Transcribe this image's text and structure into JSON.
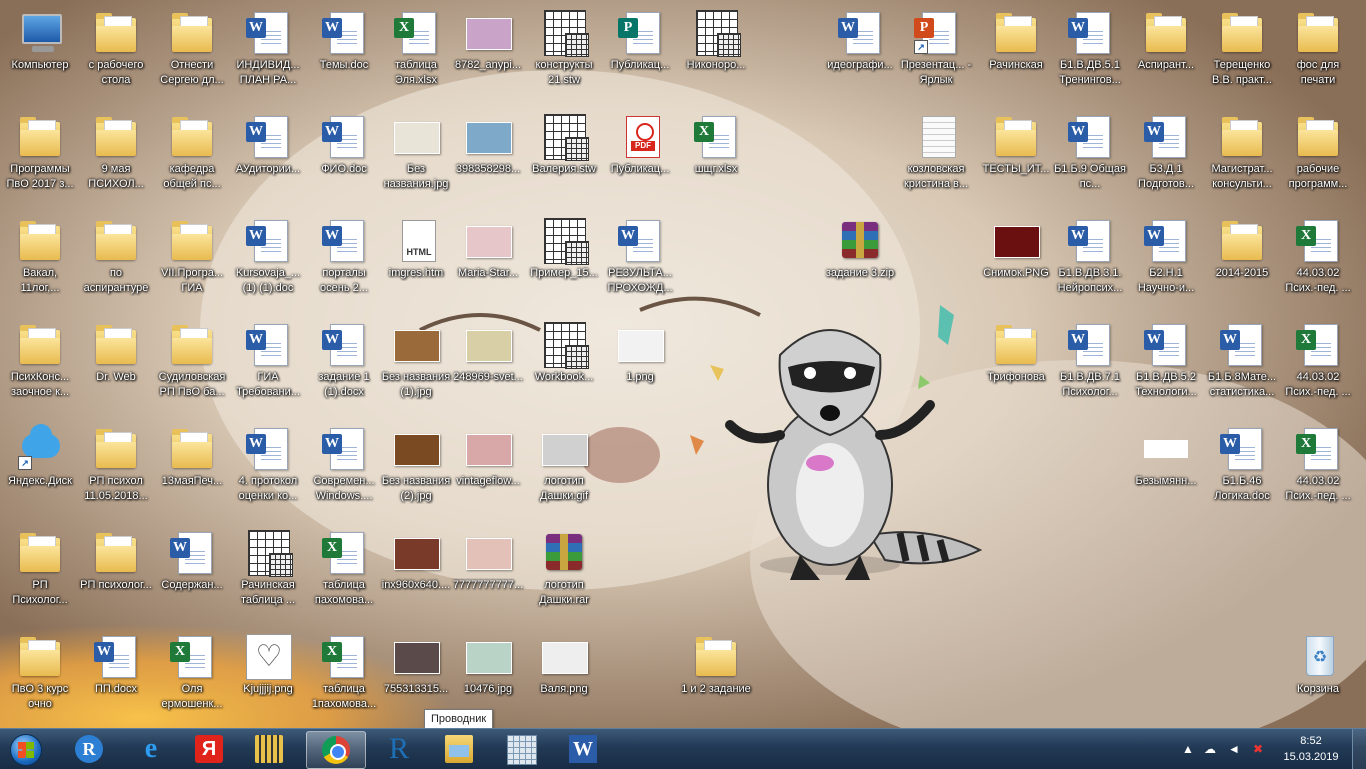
{
  "desktop": {
    "icons": [
      {
        "label": "Компьютер",
        "type": "computer",
        "col": 0,
        "row": 0
      },
      {
        "label": "с рабочего стола",
        "type": "folder",
        "col": 1,
        "row": 0
      },
      {
        "label": "Отнести Сергею дл...",
        "type": "folder",
        "col": 2,
        "row": 0
      },
      {
        "label": "ИНДИВИД... ПЛАН РА...",
        "type": "word",
        "col": 3,
        "row": 0
      },
      {
        "label": "Темы.doc",
        "type": "word",
        "col": 4,
        "row": 0
      },
      {
        "label": "таблица Эля.xlsx",
        "type": "excel",
        "col": 5,
        "row": 0
      },
      {
        "label": "8782_anypi...",
        "type": "photo",
        "col": 6,
        "row": 0,
        "color": "#c9a3c8"
      },
      {
        "label": "конструкты 21.stw",
        "type": "stat",
        "col": 7,
        "row": 0
      },
      {
        "label": "Публикац...",
        "type": "publisher",
        "col": 8,
        "row": 0
      },
      {
        "label": "Никоноро...",
        "type": "stat",
        "col": 9,
        "row": 0
      },
      {
        "label": "идеографи...",
        "type": "word",
        "col": 11,
        "row": 0
      },
      {
        "label": "Презентац... - Ярлык",
        "type": "ppt",
        "col": 12,
        "row": 0,
        "shortcut": true
      },
      {
        "label": "Рачинская",
        "type": "folder",
        "col": 13,
        "row": 0
      },
      {
        "label": "Б1.В.ДВ.5.1 Тренингов...",
        "type": "word",
        "col": 14,
        "row": 0
      },
      {
        "label": "Аспирант...",
        "type": "folder",
        "col": 15,
        "row": 0
      },
      {
        "label": "Терещенко В.В. практ...",
        "type": "folder",
        "col": 16,
        "row": 0
      },
      {
        "label": "фос для печати",
        "type": "folder",
        "col": 17,
        "row": 0
      },
      {
        "label": "Программы ПвО 2017 з...",
        "type": "folder",
        "col": 0,
        "row": 1
      },
      {
        "label": "9 мая ПСИХОЛ...",
        "type": "folder",
        "col": 1,
        "row": 1
      },
      {
        "label": "кафедра общей пс...",
        "type": "folder",
        "col": 2,
        "row": 1
      },
      {
        "label": "АУдитории...",
        "type": "word",
        "col": 3,
        "row": 1
      },
      {
        "label": "ФИО.doc",
        "type": "word",
        "col": 4,
        "row": 1
      },
      {
        "label": "Без названия.jpg",
        "type": "photo",
        "col": 5,
        "row": 1,
        "color": "#e8e4d8"
      },
      {
        "label": "398358298...",
        "type": "photo",
        "col": 6,
        "row": 1,
        "color": "#7fa9c9"
      },
      {
        "label": "Валерия.stw",
        "type": "stat",
        "col": 7,
        "row": 1
      },
      {
        "label": "Публикац...",
        "type": "pdf",
        "col": 8,
        "row": 1
      },
      {
        "label": "шщг.xlsx",
        "type": "excel",
        "col": 9,
        "row": 1
      },
      {
        "label": "козловская кристина в...",
        "type": "blank",
        "col": 12,
        "row": 1
      },
      {
        "label": "ТЕСТЫ_ИТ...",
        "type": "folder",
        "col": 13,
        "row": 1
      },
      {
        "label": "Б1.Б.9 Общая пс...",
        "type": "word",
        "col": 14,
        "row": 1
      },
      {
        "label": "Б3.Д.1 Подготов...",
        "type": "word",
        "col": 15,
        "row": 1
      },
      {
        "label": "Магистрат... консульти...",
        "type": "folder",
        "col": 16,
        "row": 1
      },
      {
        "label": "рабочие программ...",
        "type": "folder",
        "col": 17,
        "row": 1
      },
      {
        "label": "Вакал, 11лог,...",
        "type": "folder",
        "col": 0,
        "row": 2
      },
      {
        "label": "по аспирантуре",
        "type": "folder",
        "col": 1,
        "row": 2
      },
      {
        "label": "VII.Програ... ГИА",
        "type": "folder",
        "col": 2,
        "row": 2
      },
      {
        "label": "Kursovaja_... (1) (1).doc",
        "type": "word",
        "col": 3,
        "row": 2
      },
      {
        "label": "порталы осень 2...",
        "type": "word",
        "col": 4,
        "row": 2
      },
      {
        "label": "imgres.htm",
        "type": "html",
        "col": 5,
        "row": 2
      },
      {
        "label": "Maria-Star...",
        "type": "photo",
        "col": 6,
        "row": 2,
        "color": "#e6c6c9"
      },
      {
        "label": "Пример_15...",
        "type": "stat",
        "col": 7,
        "row": 2
      },
      {
        "label": "РЕЗУЛЬТА... ПРОХОЖД...",
        "type": "word",
        "col": 8,
        "row": 2
      },
      {
        "label": "задание 3.zip",
        "type": "zip",
        "col": 11,
        "row": 2
      },
      {
        "label": "Снимок.PNG",
        "type": "photo",
        "col": 13,
        "row": 2,
        "color": "#6a1010"
      },
      {
        "label": "Б1.В.ДВ.3.1. Нейропсих...",
        "type": "word",
        "col": 14,
        "row": 2
      },
      {
        "label": "Б2.Н.1 Научно-и...",
        "type": "word",
        "col": 15,
        "row": 2
      },
      {
        "label": "2014-2015",
        "type": "folder",
        "col": 16,
        "row": 2
      },
      {
        "label": "44.03.02 Псих.-пед. ...",
        "type": "excel",
        "col": 17,
        "row": 2
      },
      {
        "label": "ПсихКонс... заочное к...",
        "type": "folder",
        "col": 0,
        "row": 3
      },
      {
        "label": "Dr. Web",
        "type": "folder",
        "col": 1,
        "row": 3
      },
      {
        "label": "Судиловская РП ПвО ба...",
        "type": "folder",
        "col": 2,
        "row": 3
      },
      {
        "label": "ГИА Требовани...",
        "type": "word",
        "col": 3,
        "row": 3
      },
      {
        "label": "задание 1 (1).docx",
        "type": "word",
        "col": 4,
        "row": 3
      },
      {
        "label": "Без названия (1).jpg",
        "type": "photo",
        "col": 5,
        "row": 3,
        "color": "#9a6a3a"
      },
      {
        "label": "248969-svet...",
        "type": "photo",
        "col": 6,
        "row": 3,
        "color": "#d8cfa6"
      },
      {
        "label": "Workbook...",
        "type": "stat",
        "col": 7,
        "row": 3
      },
      {
        "label": "1.png",
        "type": "photo",
        "col": 8,
        "row": 3,
        "color": "#f2f2f2"
      },
      {
        "label": "Трифонова",
        "type": "folder",
        "col": 13,
        "row": 3
      },
      {
        "label": "Б1.В.ДВ.7.1 Психолог...",
        "type": "word",
        "col": 14,
        "row": 3
      },
      {
        "label": "Б1.В.ДВ.5.2 Технологи...",
        "type": "word",
        "col": 15,
        "row": 3
      },
      {
        "label": "Б1.Б.8Мате... статистика...",
        "type": "word",
        "col": 16,
        "row": 3
      },
      {
        "label": "44.03.02 Псих.-пед. ...",
        "type": "excel",
        "col": 17,
        "row": 3
      },
      {
        "label": "Яндекс.Диск",
        "type": "yadisk",
        "col": 0,
        "row": 4,
        "shortcut": true
      },
      {
        "label": "РП психол 11.05.2018...",
        "type": "folder",
        "col": 1,
        "row": 4
      },
      {
        "label": "13маяПеч...",
        "type": "folder",
        "col": 2,
        "row": 4
      },
      {
        "label": "4. протокол оценки ко...",
        "type": "word",
        "col": 3,
        "row": 4
      },
      {
        "label": "Современ... Windows....",
        "type": "word",
        "col": 4,
        "row": 4
      },
      {
        "label": "Без названия (2).jpg",
        "type": "photo",
        "col": 5,
        "row": 4,
        "color": "#7a4a22"
      },
      {
        "label": "vintageflow...",
        "type": "photo",
        "col": 6,
        "row": 4,
        "color": "#d8a7a7"
      },
      {
        "label": "логотип Дашки.gif",
        "type": "photo",
        "col": 7,
        "row": 4,
        "color": "#d0d0d0"
      },
      {
        "label": "Безымянн...",
        "type": "whiterect",
        "col": 15,
        "row": 4
      },
      {
        "label": "Б1.Б.46 Логика.doc",
        "type": "word",
        "col": 16,
        "row": 4
      },
      {
        "label": "44.03.02 Псих.-пед. ...",
        "type": "excel",
        "col": 17,
        "row": 4
      },
      {
        "label": "РП Психолог...",
        "type": "folder",
        "col": 0,
        "row": 5
      },
      {
        "label": "РП психолог...",
        "type": "folder",
        "col": 1,
        "row": 5
      },
      {
        "label": "Содержан...",
        "type": "word",
        "col": 2,
        "row": 5
      },
      {
        "label": "Рачинская таблица ...",
        "type": "stat",
        "col": 3,
        "row": 5
      },
      {
        "label": "таблица пахомова...",
        "type": "excel",
        "col": 4,
        "row": 5
      },
      {
        "label": "inx960x640....",
        "type": "photo",
        "col": 5,
        "row": 5,
        "color": "#7a3a2a"
      },
      {
        "label": "7777777777...",
        "type": "photo",
        "col": 6,
        "row": 5,
        "color": "#e3c0b8"
      },
      {
        "label": "логотип Дашки.rar",
        "type": "zip",
        "col": 7,
        "row": 5
      },
      {
        "label": "ПвО 3 курс очно",
        "type": "folder",
        "col": 0,
        "row": 6
      },
      {
        "label": "ПП.docx",
        "type": "word",
        "col": 1,
        "row": 6
      },
      {
        "label": "Оля ермошенк...",
        "type": "excel",
        "col": 2,
        "row": 6
      },
      {
        "label": "Kjujjjij.png",
        "type": "heart",
        "col": 3,
        "row": 6
      },
      {
        "label": "таблица 1пахомова...",
        "type": "excel",
        "col": 4,
        "row": 6
      },
      {
        "label": "755313315...",
        "type": "photo",
        "col": 5,
        "row": 6,
        "color": "#5a4a4a"
      },
      {
        "label": "10476.jpg",
        "type": "photo",
        "col": 6,
        "row": 6,
        "color": "#b9d3c6"
      },
      {
        "label": "Валя.png",
        "type": "photo",
        "col": 7,
        "row": 6,
        "color": "#eeeeee"
      },
      {
        "label": "1 и 2 задание",
        "type": "folder",
        "col": 9,
        "row": 6
      },
      {
        "label": "Корзина",
        "type": "recycle",
        "col": 17,
        "row": 6
      }
    ]
  },
  "tooltip": "Проводник",
  "taskbar": {
    "items": [
      {
        "name": "r-app",
        "logo": "R"
      },
      {
        "name": "internet-explorer",
        "logo": "e"
      },
      {
        "name": "yandex-browser",
        "logo": "Я"
      },
      {
        "name": "statistica",
        "logo": ""
      },
      {
        "name": "chrome",
        "logo": "",
        "active": true
      },
      {
        "name": "rstudio",
        "logo": "R"
      },
      {
        "name": "explorer",
        "logo": ""
      },
      {
        "name": "calculator",
        "logo": ""
      },
      {
        "name": "word",
        "logo": "W"
      }
    ],
    "clock": {
      "time": "8:52",
      "date": "15.03.2019"
    }
  }
}
